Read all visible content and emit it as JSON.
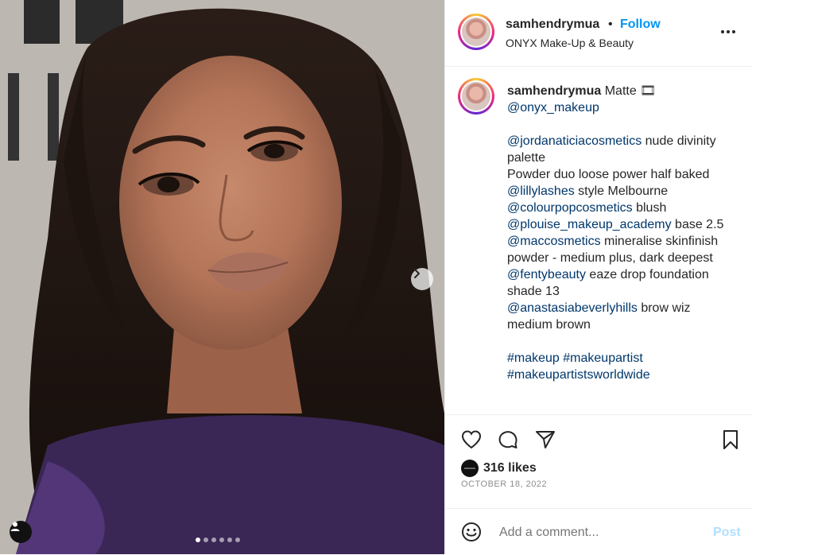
{
  "post": {
    "header": {
      "username": "samhendrymua",
      "separator": "•",
      "follow_label": "Follow",
      "location": "ONYX Make-Up & Beauty"
    },
    "caption": {
      "username": "samhendrymua",
      "lead_text": "Matte 🎞",
      "lines": [
        {
          "mention": "@onyx_makeup",
          "text": ""
        },
        {
          "mention": "",
          "text": ""
        },
        {
          "mention": "@jordanaticiacosmetics",
          "text": " nude divinity palette"
        },
        {
          "mention": "",
          "text": "Powder duo loose power half baked"
        },
        {
          "mention": "@lillylashes",
          "text": " style Melbourne"
        },
        {
          "mention": "@colourpopcosmetics",
          "text": " blush"
        },
        {
          "mention": "@plouise_makeup_academy",
          "text": " base 2.5"
        },
        {
          "mention": "@maccosmetics",
          "text": " mineralise skinfinish powder - medium plus, dark deepest"
        },
        {
          "mention": "@fentybeauty",
          "text": " eaze drop foundation shade 13"
        },
        {
          "mention": "@anastasiabeverlyhills",
          "text": " brow wiz medium brown"
        },
        {
          "mention": "",
          "text": ""
        },
        {
          "mention": "#makeup #makeupartist",
          "text": ""
        },
        {
          "mention": "#makeupartistsworldwide",
          "text": ""
        }
      ]
    },
    "likes": "316 likes",
    "date": "OCTOBER 18, 2022",
    "comment": {
      "placeholder": "Add a comment...",
      "post_label": "Post"
    },
    "carousel": {
      "count": 6,
      "active_index": 0
    },
    "icons": {
      "like": "heart-icon",
      "comment": "comment-icon",
      "share": "paper-plane-icon",
      "save": "bookmark-icon",
      "more": "more-icon",
      "next": "chevron-right-icon",
      "emoji": "emoji-icon",
      "tagged": "user-tag-icon"
    },
    "colors": {
      "follow": "#0095f6",
      "mention": "#00376b",
      "post_disabled": "#b2dffc",
      "muted": "#8e8e8e"
    }
  }
}
